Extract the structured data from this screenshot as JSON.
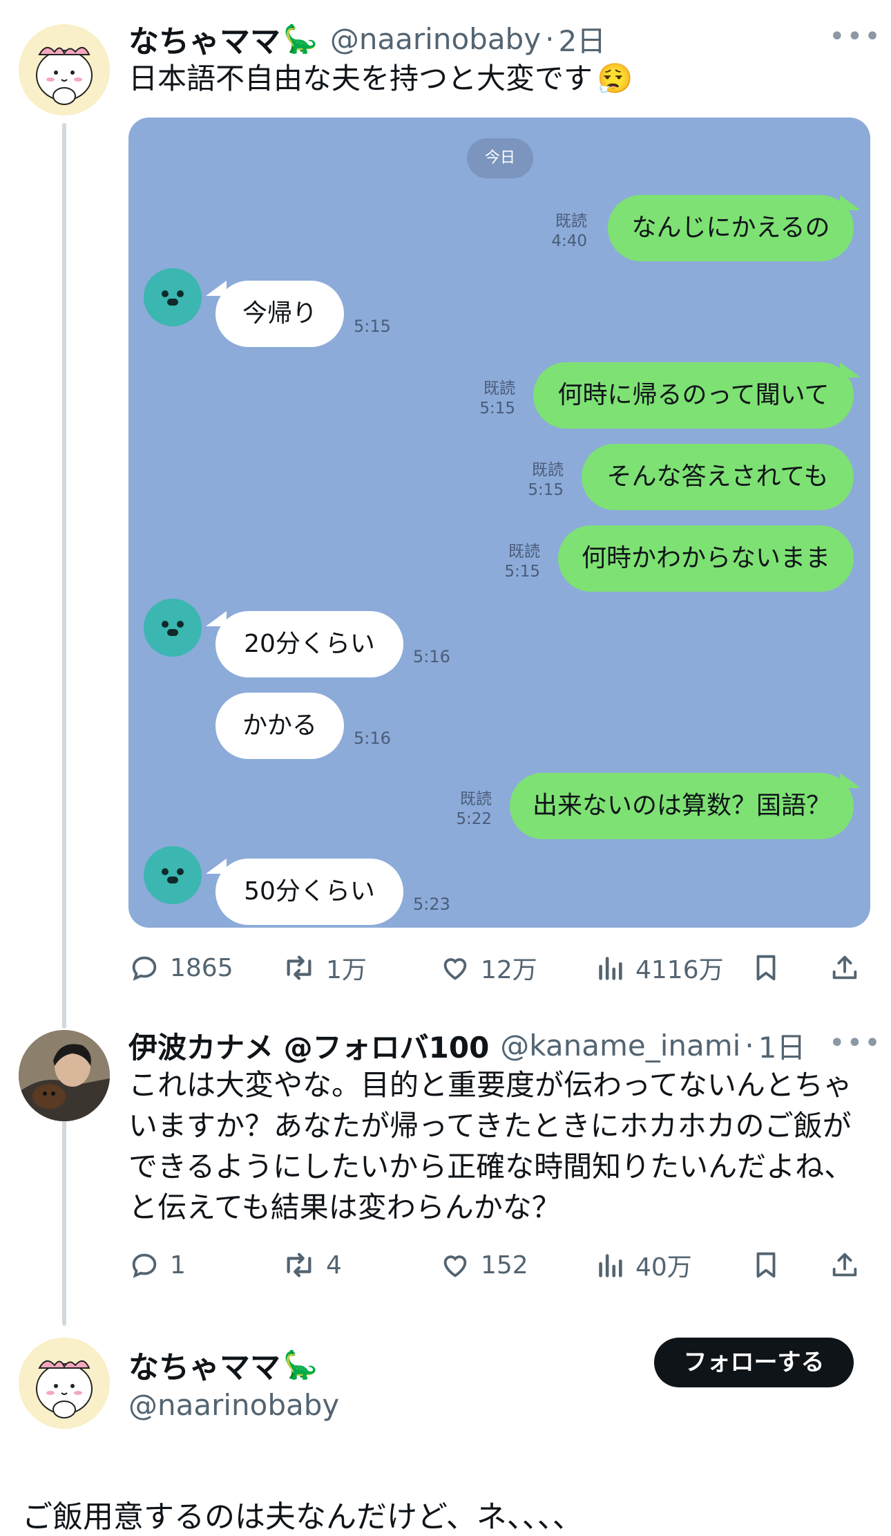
{
  "tweet1": {
    "author_name": "なちゃママ",
    "author_emoji": "🦕",
    "handle": "@naarinobaby",
    "age": "2日",
    "text": "日本語不自由な夫を持つと大変です",
    "text_emoji": "😮‍💨",
    "more": "•••",
    "stats": {
      "replies": "1865",
      "retweets": "1万",
      "likes": "12万",
      "views": "4116万"
    }
  },
  "chat": {
    "date_label": "今日",
    "read_label": "既読",
    "messages": [
      {
        "side": "right",
        "text": "なんじにかえるの",
        "time": "4:40"
      },
      {
        "side": "left",
        "text": "今帰り",
        "time": "5:15"
      },
      {
        "side": "right",
        "text": "何時に帰るのって聞いて",
        "time": "5:15"
      },
      {
        "side": "right",
        "text": "そんな答えされても",
        "time": "5:15"
      },
      {
        "side": "right",
        "text": "何時かわからないまま",
        "time": "5:15"
      },
      {
        "side": "left",
        "text": "20分くらい",
        "time": "5:16"
      },
      {
        "side": "left",
        "text": "かかる",
        "time": "5:16"
      },
      {
        "side": "right",
        "text": "出来ないのは算数？国語？",
        "time": "5:22"
      },
      {
        "side": "left",
        "text": "50分くらい",
        "time": "5:23"
      }
    ]
  },
  "tweet2": {
    "author_name": "伊波カナメ @フォロバ100",
    "handle": "@kaname_inami",
    "age": "1日",
    "more": "•••",
    "text_lines": [
      "これは大変やな。目的と重要度が伝わってないんとちゃ",
      "いますか？あなたが帰ってきたときにホカホカのご飯が",
      "できるようにしたいから正確な時間知りたいんだよね、",
      "と伝えても結果は変わらんかな？"
    ],
    "stats": {
      "replies": "1",
      "retweets": "4",
      "likes": "152",
      "views": "40万"
    }
  },
  "tweet3": {
    "author_name": "なちゃママ",
    "author_emoji": "🦕",
    "handle": "@naarinobaby",
    "follow_label": "フォローする",
    "text": "ご飯用意するのは夫なんだけど、ネ、、、、"
  },
  "colors": {
    "chat_bg": "#8cabd9",
    "green_bubble": "#7ee173",
    "follow_bg": "#0f1419",
    "muted": "#536471"
  }
}
